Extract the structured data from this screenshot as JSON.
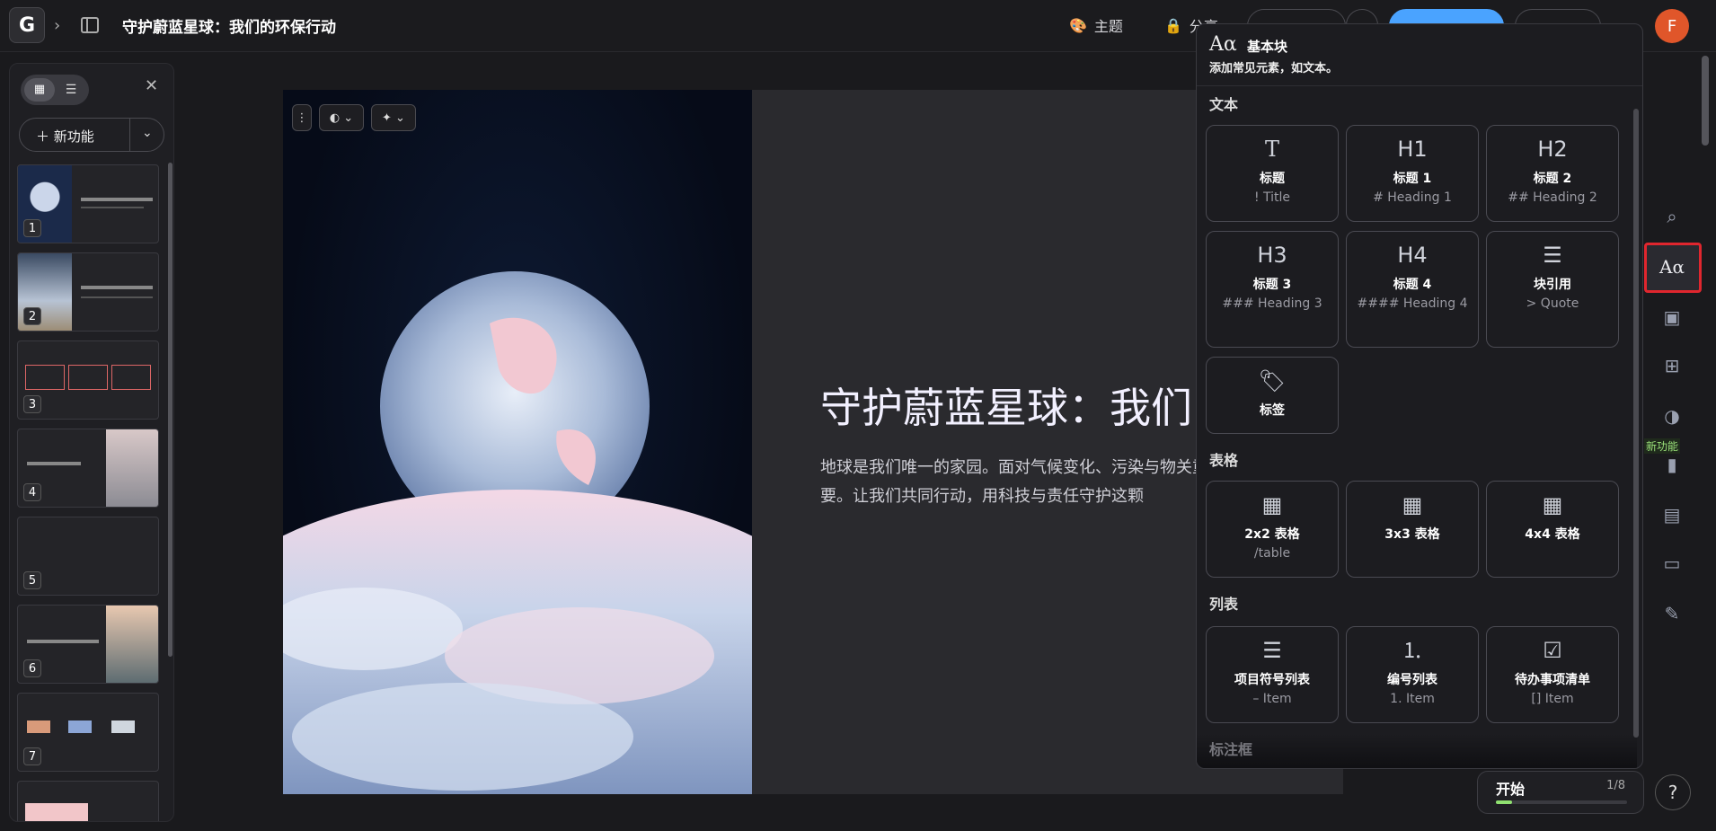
{
  "header": {
    "logo": "G",
    "doc_title": "守护蔚蓝星球：我们的环保行动",
    "theme_label": "主题",
    "share_label": "分享",
    "avatar_initial": "F"
  },
  "left_panel": {
    "new_feature_label": "新功能",
    "thumbnails": [
      {
        "num": "1"
      },
      {
        "num": "2"
      },
      {
        "num": "3"
      },
      {
        "num": "4"
      },
      {
        "num": "5"
      },
      {
        "num": "6"
      },
      {
        "num": "7"
      }
    ]
  },
  "slide": {
    "heading": "守护蔚蓝星球：我们",
    "body": "地球是我们唯一的家园。面对气候变化、污染与物关重要。让我们共同行动，用科技与责任守护这颗"
  },
  "block_panel": {
    "title": "基本块",
    "subtitle": "添加常见元素，如文本。",
    "sections": {
      "text": "文本",
      "table": "表格",
      "list": "列表",
      "callout": "标注框"
    },
    "text_cards": [
      {
        "icon": "T",
        "label": "标题",
        "sub": "! Title"
      },
      {
        "icon": "H1",
        "label": "标题 1",
        "sub": "# Heading 1"
      },
      {
        "icon": "H2",
        "label": "标题 2",
        "sub": "## Heading 2"
      },
      {
        "icon": "H3",
        "label": "标题 3",
        "sub": "### Heading 3"
      },
      {
        "icon": "H4",
        "label": "标题 4",
        "sub": "#### Heading 4"
      },
      {
        "icon": "quote",
        "label": "块引用",
        "sub": "> Quote"
      },
      {
        "icon": "tag",
        "label": "标签",
        "sub": ""
      }
    ],
    "table_cards": [
      {
        "label": "2x2 表格",
        "sub": "/table"
      },
      {
        "label": "3x3 表格",
        "sub": ""
      },
      {
        "label": "4x4 表格",
        "sub": ""
      }
    ],
    "list_cards": [
      {
        "label": "项目符号列表",
        "sub": "– Item"
      },
      {
        "label": "编号列表",
        "sub": "1. Item"
      },
      {
        "label": "待办事项清单",
        "sub": "[] Item"
      }
    ]
  },
  "rail": {
    "new_badge": "新功能"
  },
  "start_widget": {
    "label": "开始",
    "count": "1/8",
    "progress": 0.125
  },
  "help": "?"
}
